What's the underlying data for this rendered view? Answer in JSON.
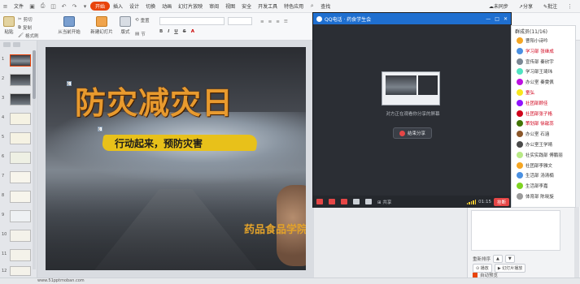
{
  "menubar": {
    "file": "文件",
    "tabs": [
      "开始",
      "插入",
      "设计",
      "切换",
      "动画",
      "幻灯片放映",
      "审阅",
      "视图",
      "安全",
      "开发工具",
      "特色应用"
    ],
    "active_tab": "开始",
    "search": "查找",
    "sync": "未同步",
    "share": "分享",
    "batch": "批注"
  },
  "ribbon": {
    "paste": "粘贴",
    "cut": "剪切",
    "copy": "复制",
    "format_painter": "格式刷",
    "from_start": "从当前开始",
    "new_slide": "新建幻灯片",
    "layout": "版式",
    "section": "节",
    "reset": "重置"
  },
  "thumbnails": {
    "numbers": [
      "1",
      "2",
      "3",
      "4",
      "5",
      "6",
      "7",
      "8",
      "9",
      "10",
      "11",
      "12"
    ]
  },
  "slide": {
    "title": "防灾减灾日",
    "slogan": "行动起来，预防灾害",
    "author": "药品食品学院   孙云莉",
    "marker": "0"
  },
  "qq_share": {
    "window_title": "QQ电话 · 药食学生会",
    "status_text": "对方正在观看你分享的屏幕",
    "end_button": "结束分享",
    "toolbar_label": "共享",
    "timer": "01:15",
    "hangup": "挂断"
  },
  "members": {
    "header": "群成员(11/16)",
    "list": [
      {
        "name": "曹阳小诗吟",
        "color": "#333333"
      },
      {
        "name": "学习部 张继成",
        "color": "#d0021b"
      },
      {
        "name": "宣传部 秦欣宇",
        "color": "#333333"
      },
      {
        "name": "学习部王琦玮",
        "color": "#333333"
      },
      {
        "name": "办公室 秦雯佩",
        "color": "#333333"
      },
      {
        "name": "童弘",
        "color": "#d0021b"
      },
      {
        "name": "社团部顾佳",
        "color": "#d0021b"
      },
      {
        "name": "社团部张子格",
        "color": "#d0021b"
      },
      {
        "name": "策划部 徐歆蕊",
        "color": "#d0021b"
      },
      {
        "name": "办公室 石涵",
        "color": "#333333"
      },
      {
        "name": "办公室王学晴",
        "color": "#333333"
      },
      {
        "name": "社实实践部 傅鹏丽",
        "color": "#333333"
      },
      {
        "name": "社团部李雅文",
        "color": "#333333"
      },
      {
        "name": "生活部 汤清楠",
        "color": "#333333"
      },
      {
        "name": "生活部李嘉",
        "color": "#333333"
      },
      {
        "name": "体育部 陈晓旋",
        "color": "#333333"
      }
    ]
  },
  "taskpane": {
    "play_button": "播放",
    "slideshow_button": "幻灯片播放",
    "autopreview": "自动预览",
    "order_label": "重新排序"
  },
  "statusbar": {
    "text": "www.51pptmoban.com"
  }
}
